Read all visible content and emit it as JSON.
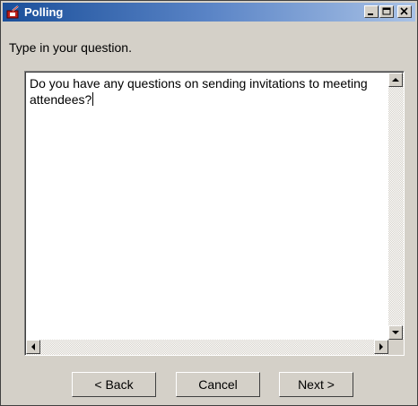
{
  "window": {
    "title": "Polling"
  },
  "prompt": {
    "label": "Type in your question."
  },
  "question": {
    "text": "Do you have any questions on sending invitations to meeting attendees?"
  },
  "buttons": {
    "back": "< Back",
    "cancel": "Cancel",
    "next": "Next >"
  },
  "icons": {
    "app": "polling-icon",
    "minimize": "minimize-icon",
    "maximize": "maximize-icon",
    "close": "close-icon"
  }
}
